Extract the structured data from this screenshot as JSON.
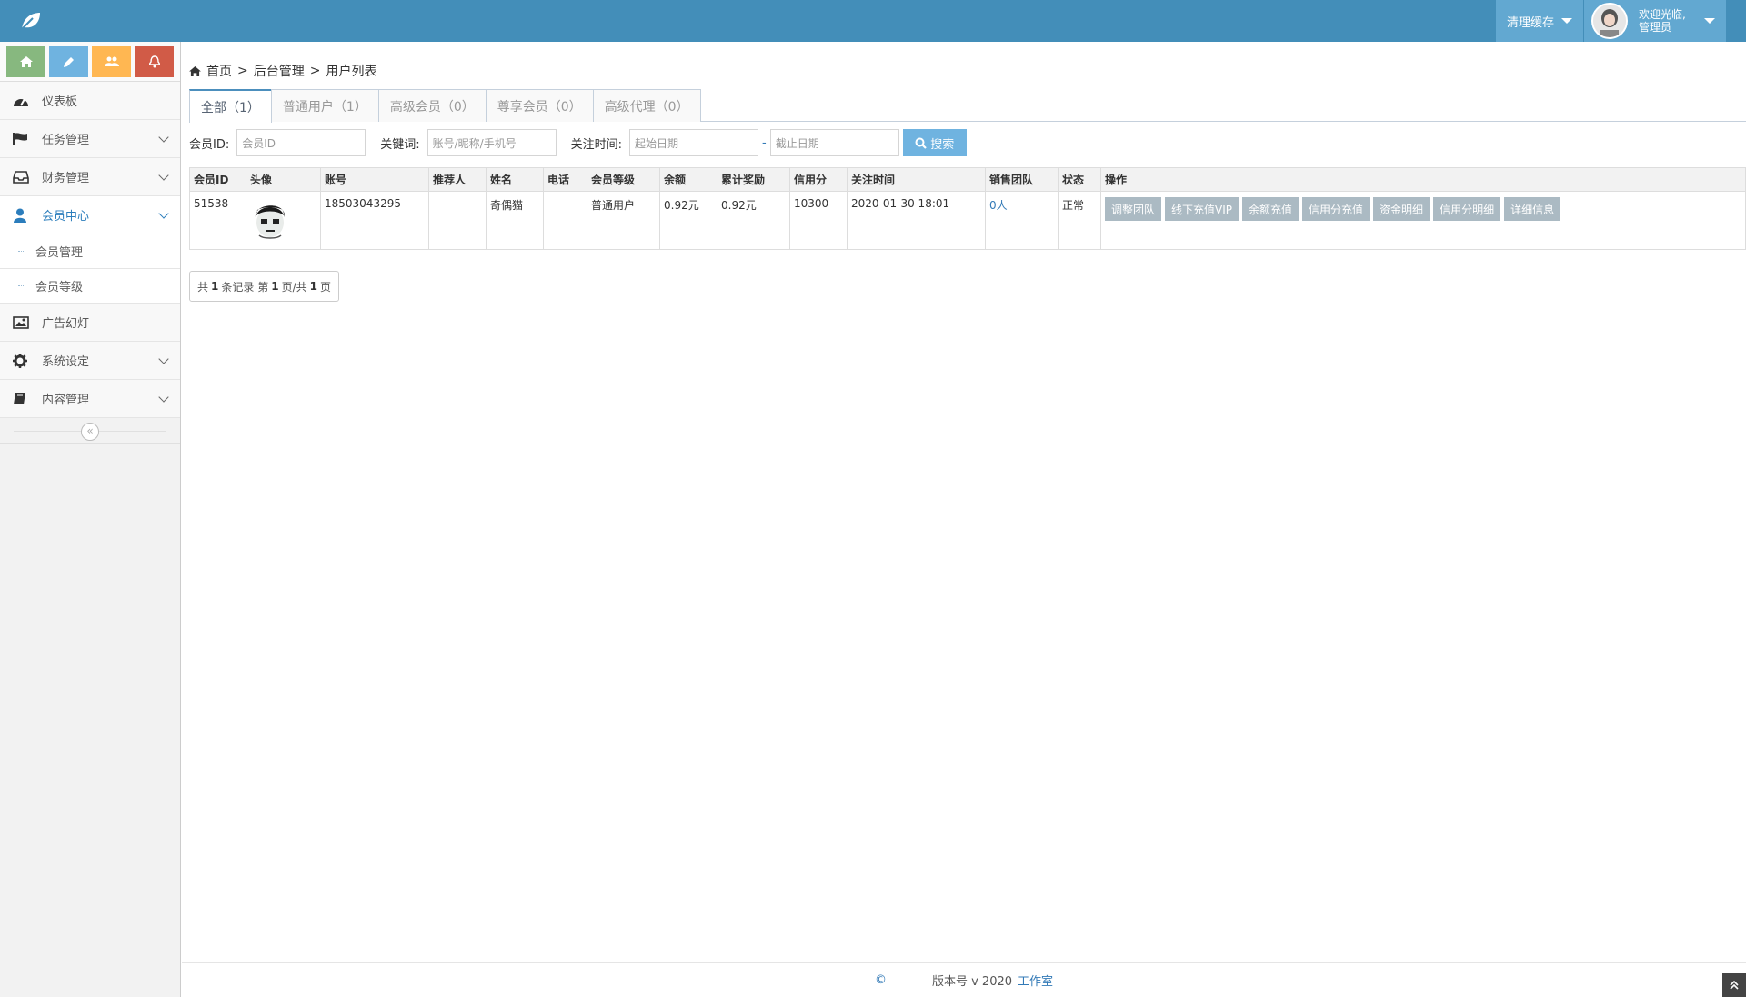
{
  "header": {
    "clear_cache": "清理缓存",
    "welcome": "欢迎光临,",
    "role": "管理员"
  },
  "sidebar": {
    "items": [
      {
        "label": "仪表板",
        "icon": "dashboard-icon"
      },
      {
        "label": "任务管理",
        "icon": "flag-icon"
      },
      {
        "label": "财务管理",
        "icon": "inbox-icon"
      },
      {
        "label": "会员中心",
        "icon": "user-icon"
      },
      {
        "label": "广告幻灯",
        "icon": "picture-icon"
      },
      {
        "label": "系统设定",
        "icon": "gear-icon"
      },
      {
        "label": "内容管理",
        "icon": "book-icon"
      }
    ],
    "sub_items": [
      "会员管理",
      "会员等级"
    ]
  },
  "breadcrumb": {
    "home": "首页",
    "sep": ">",
    "level2": "后台管理",
    "level3": "用户列表"
  },
  "tabs": [
    "全部（1）",
    "普通用户（1）",
    "高级会员（0）",
    "尊享会员（0）",
    "高级代理（0）"
  ],
  "filters": {
    "member_id_label": "会员ID:",
    "member_id_placeholder": "会员ID",
    "keyword_label": "关键词:",
    "keyword_placeholder": "账号/昵称/手机号",
    "follow_time_label": "关注时间:",
    "start_placeholder": "起始日期",
    "dash": "-",
    "end_placeholder": "截止日期",
    "search_button": "搜索"
  },
  "table": {
    "headers": [
      "会员ID",
      "头像",
      "账号",
      "推荐人",
      "姓名",
      "电话",
      "会员等级",
      "余额",
      "累计奖励",
      "信用分",
      "关注时间",
      "销售团队",
      "状态",
      "操作"
    ],
    "row": {
      "id": "51538",
      "account": "18503043295",
      "referrer": "",
      "name": "奇偶猫",
      "phone": "",
      "level": "普通用户",
      "balance": "0.92元",
      "reward": "0.92元",
      "credit": "10300",
      "follow_time": "2020-01-30 18:01",
      "team": "0人",
      "status": "正常"
    },
    "actions": [
      "调整团队",
      "线下充值VIP",
      "余额充值",
      "信用分充值",
      "资金明细",
      "信用分明细",
      "详细信息"
    ]
  },
  "pager": {
    "p1": "共",
    "total": "1",
    "p2": "条记录 第",
    "page": "1",
    "p3": "页/共",
    "pages": "1",
    "p4": "页"
  },
  "footer": {
    "copyright": "©",
    "version": "版本号 v 2020",
    "studio": "工作室"
  },
  "colors": {
    "topbar": "#438eb9",
    "accent": "#6fb3e0",
    "op_button": "#abbac3"
  }
}
